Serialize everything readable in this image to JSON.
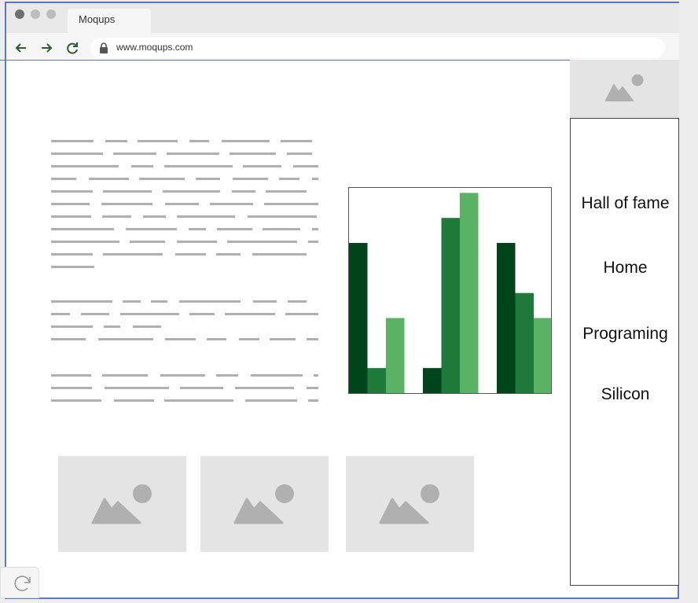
{
  "browser": {
    "tab_title": "Moqups",
    "url": "www.moqups.com"
  },
  "sidebar": {
    "items": [
      {
        "label": "Hall of fame"
      },
      {
        "label": "Home"
      },
      {
        "label": "Programing"
      },
      {
        "label": "Silicon"
      }
    ]
  },
  "colors": {
    "dark_green": "#00441b",
    "mid_green": "#1d7a38",
    "light_green": "#5ab264",
    "placeholder_gray": "#e4e4e4",
    "frame_blue": "#5a78c7"
  },
  "chart_data": {
    "type": "bar",
    "categories": [
      "",
      "",
      ""
    ],
    "series": [
      {
        "values": [
          6,
          1,
          6
        ]
      },
      {
        "values": [
          1,
          7,
          4
        ]
      },
      {
        "values": [
          3,
          8,
          3
        ]
      }
    ],
    "ylim": [
      0,
      8.2
    ]
  }
}
